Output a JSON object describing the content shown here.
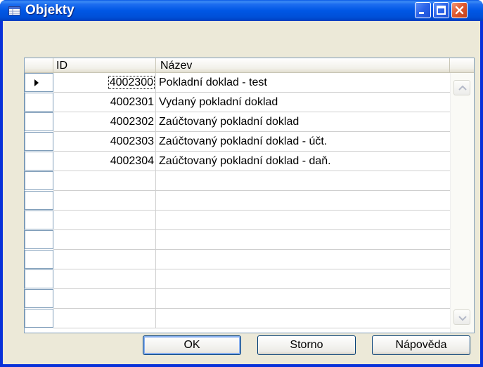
{
  "window": {
    "title": "Objekty"
  },
  "table": {
    "columns": [
      "ID",
      "Název"
    ],
    "rows": [
      {
        "id": "4002300",
        "name": "Pokladní doklad - test"
      },
      {
        "id": "4002301",
        "name": "Vydaný pokladní doklad"
      },
      {
        "id": "4002302",
        "name": "Zaúčtovaný pokladní doklad"
      },
      {
        "id": "4002303",
        "name": "Zaúčtovaný pokladní doklad - účt."
      },
      {
        "id": "4002304",
        "name": "Zaúčtovaný pokladní doklad - daň."
      },
      {
        "id": "",
        "name": ""
      },
      {
        "id": "",
        "name": ""
      },
      {
        "id": "",
        "name": ""
      },
      {
        "id": "",
        "name": ""
      },
      {
        "id": "",
        "name": ""
      },
      {
        "id": "",
        "name": ""
      },
      {
        "id": "",
        "name": ""
      },
      {
        "id": "",
        "name": ""
      }
    ]
  },
  "buttons": {
    "ok": "OK",
    "storno": "Storno",
    "help": "Nápověda"
  },
  "icons": {
    "title": "table-icon",
    "minimize": "minimize-icon",
    "maximize": "maximize-icon",
    "close": "close-icon",
    "current_row": "row-pointer-icon",
    "scroll_up": "chevron-up-icon",
    "scroll_down": "chevron-down-icon"
  },
  "colors": {
    "titlebar": "#0054e3",
    "dialog": "#ece9d8",
    "close": "#e05a30",
    "grid_border": "#7f9db9"
  }
}
